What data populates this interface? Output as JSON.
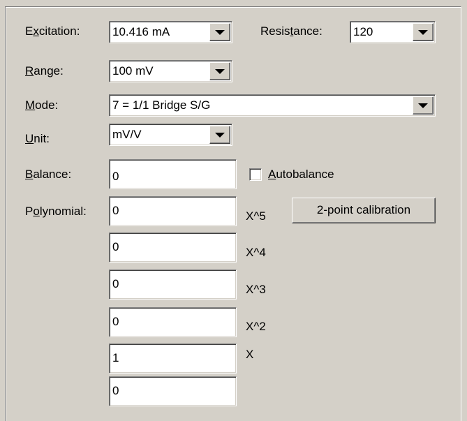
{
  "labels": {
    "excitation_pre": "E",
    "excitation_key": "x",
    "excitation_post": "citation:",
    "resistance_pre": "Resis",
    "resistance_key": "t",
    "resistance_post": "ance:",
    "range_key": "R",
    "range_post": "ange:",
    "mode_key": "M",
    "mode_post": "ode:",
    "unit_key": "U",
    "unit_post": "nit:",
    "balance_key": "B",
    "balance_post": "alance:",
    "polynomial_pre": "P",
    "polynomial_key": "o",
    "polynomial_post": "lynomial:",
    "autobalance_key": "A",
    "autobalance_post": "utobalance"
  },
  "combos": {
    "excitation": "10.416 mA",
    "resistance": "120",
    "range": "100 mV",
    "mode": "7 = 1/1 Bridge S/G",
    "unit": "mV/V"
  },
  "balance_value": "0",
  "autobalance_checked": false,
  "polynomial": [
    {
      "value": "0",
      "term": "X^5"
    },
    {
      "value": "0",
      "term": "X^4"
    },
    {
      "value": "0",
      "term": "X^3"
    },
    {
      "value": "0",
      "term": "X^2"
    },
    {
      "value": "1",
      "term": "X"
    },
    {
      "value": "0",
      "term": ""
    }
  ],
  "calibration_button": "2-point calibration"
}
